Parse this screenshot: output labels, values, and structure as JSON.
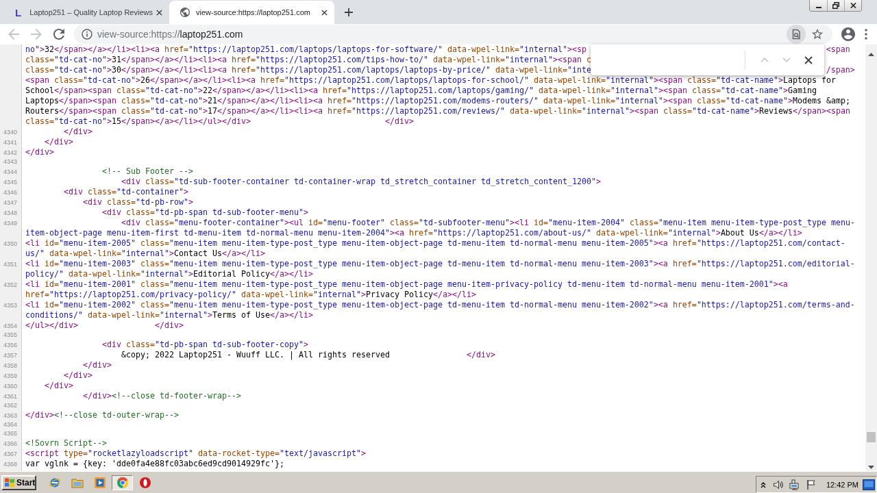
{
  "browser": {
    "tabs": [
      {
        "icon_letter": "L",
        "title": "Laptop251 – Quality Laptop Reviews",
        "selected": false
      },
      {
        "title": "view-source:https://laptop251.com",
        "selected": true
      }
    ],
    "toolbar": {
      "back": {
        "disabled": true
      },
      "forward": {
        "disabled": true
      },
      "address": {
        "scheme": "view-source:https://",
        "host": "laptop251.com"
      }
    },
    "find_bar": {
      "previous": {
        "disabled": true
      },
      "next": {
        "disabled": true
      }
    }
  },
  "source": {
    "lines": [
      {
        "rows": [
          {
            "segments": [
              {
                "kind": "value",
                "text": "no\""
              },
              {
                "kind": "tag",
                "text": ">"
              },
              {
                "kind": "text",
                "text": "32"
              },
              {
                "kind": "tag",
                "text": "</span></a></li><li><a "
              },
              {
                "kind": "attr",
                "text": "href="
              },
              {
                "kind": "value",
                "text": "\"https://laptop251.com/laptops/laptops-for-software/\""
              },
              {
                "kind": "attr",
                "text": " data-wpel-link="
              },
              {
                "kind": "value",
                "text": "\"internal\""
              },
              {
                "kind": "tag",
                "text": "><sp"
              }
            ],
            "right_of_find_bar": [
              {
                "kind": "tag",
                "text": "<span"
              }
            ]
          },
          {
            "segments": [
              {
                "kind": "attr",
                "text": "class="
              },
              {
                "kind": "value",
                "text": "\"td-cat-no\""
              },
              {
                "kind": "tag",
                "text": ">"
              },
              {
                "kind": "text",
                "text": "31"
              },
              {
                "kind": "tag",
                "text": "</span></a></li><li><a "
              },
              {
                "kind": "attr",
                "text": "href="
              },
              {
                "kind": "value",
                "text": "\"https://laptop251.com/tips-how-to/\""
              },
              {
                "kind": "attr",
                "text": " data-wpel-link="
              },
              {
                "kind": "value",
                "text": "\"internal\""
              },
              {
                "kind": "tag",
                "text": "><span "
              },
              {
                "kind": "attr",
                "text": "c"
              }
            ]
          },
          {
            "segments": [
              {
                "kind": "attr",
                "text": "class="
              },
              {
                "kind": "value",
                "text": "\"td-cat-no\""
              },
              {
                "kind": "tag",
                "text": ">"
              },
              {
                "kind": "text",
                "text": "30"
              },
              {
                "kind": "tag",
                "text": "</span></a></li><li><a "
              },
              {
                "kind": "attr",
                "text": "href="
              },
              {
                "kind": "value",
                "text": "\"https://laptop251.com/laptops/laptops-by-price/\""
              },
              {
                "kind": "attr",
                "text": " data-wpel-link="
              },
              {
                "kind": "value",
                "text": "\"inte"
              }
            ],
            "right_of_find_bar": [
              {
                "kind": "tag",
                "text": "/span>"
              }
            ]
          },
          {
            "segments": [
              {
                "kind": "tag",
                "text": "<span "
              },
              {
                "kind": "attr",
                "text": "class="
              },
              {
                "kind": "value",
                "text": "\"td-cat-no\""
              },
              {
                "kind": "tag",
                "text": ">"
              },
              {
                "kind": "text",
                "text": "26"
              },
              {
                "kind": "tag",
                "text": "</span></a></li><li><a "
              },
              {
                "kind": "attr",
                "text": "href="
              },
              {
                "kind": "value",
                "text": "\"https://laptop251.com/laptops/laptops-for-school/\""
              },
              {
                "kind": "attr",
                "text": " data-wpel-link="
              },
              {
                "kind": "value",
                "text": "\"internal\""
              },
              {
                "kind": "tag",
                "text": "><span "
              },
              {
                "kind": "attr",
                "text": "class="
              },
              {
                "kind": "value",
                "text": "\"td-cat-name\""
              },
              {
                "kind": "tag",
                "text": ">"
              },
              {
                "kind": "text",
                "text": "Laptops for"
              }
            ]
          },
          {
            "segments": [
              {
                "kind": "text",
                "text": "School"
              },
              {
                "kind": "tag",
                "text": "</span><span "
              },
              {
                "kind": "attr",
                "text": "class="
              },
              {
                "kind": "value",
                "text": "\"td-cat-no\""
              },
              {
                "kind": "tag",
                "text": ">"
              },
              {
                "kind": "text",
                "text": "22"
              },
              {
                "kind": "tag",
                "text": "</span></a></li><li><a "
              },
              {
                "kind": "attr",
                "text": "href="
              },
              {
                "kind": "value",
                "text": "\"https://laptop251.com/laptops/gaming/\""
              },
              {
                "kind": "attr",
                "text": " data-wpel-link="
              },
              {
                "kind": "value",
                "text": "\"internal\""
              },
              {
                "kind": "tag",
                "text": "><span "
              },
              {
                "kind": "attr",
                "text": "class="
              },
              {
                "kind": "value",
                "text": "\"td-cat-name\""
              },
              {
                "kind": "tag",
                "text": ">"
              },
              {
                "kind": "text",
                "text": "Gaming"
              }
            ]
          },
          {
            "segments": [
              {
                "kind": "text",
                "text": "Laptops"
              },
              {
                "kind": "tag",
                "text": "</span><span "
              },
              {
                "kind": "attr",
                "text": "class="
              },
              {
                "kind": "value",
                "text": "\"td-cat-no\""
              },
              {
                "kind": "tag",
                "text": ">"
              },
              {
                "kind": "text",
                "text": "21"
              },
              {
                "kind": "tag",
                "text": "</span></a></li><li><a "
              },
              {
                "kind": "attr",
                "text": "href="
              },
              {
                "kind": "value",
                "text": "\"https://laptop251.com/modems-routers/\""
              },
              {
                "kind": "attr",
                "text": " data-wpel-link="
              },
              {
                "kind": "value",
                "text": "\"internal\""
              },
              {
                "kind": "tag",
                "text": "><span "
              },
              {
                "kind": "attr",
                "text": "class="
              },
              {
                "kind": "value",
                "text": "\"td-cat-name\""
              },
              {
                "kind": "tag",
                "text": ">"
              },
              {
                "kind": "text",
                "text": "Modems &amp;"
              }
            ]
          },
          {
            "segments": [
              {
                "kind": "text",
                "text": "Routers"
              },
              {
                "kind": "tag",
                "text": "</span><span "
              },
              {
                "kind": "attr",
                "text": "class="
              },
              {
                "kind": "value",
                "text": "\"td-cat-no\""
              },
              {
                "kind": "tag",
                "text": ">"
              },
              {
                "kind": "text",
                "text": "17"
              },
              {
                "kind": "tag",
                "text": "</span></a></li><li><a "
              },
              {
                "kind": "attr",
                "text": "href="
              },
              {
                "kind": "value",
                "text": "\"https://laptop251.com/reviews/\""
              },
              {
                "kind": "attr",
                "text": " data-wpel-link="
              },
              {
                "kind": "value",
                "text": "\"internal\""
              },
              {
                "kind": "tag",
                "text": "><span "
              },
              {
                "kind": "attr",
                "text": "class="
              },
              {
                "kind": "value",
                "text": "\"td-cat-name\""
              },
              {
                "kind": "tag",
                "text": ">"
              },
              {
                "kind": "text",
                "text": "Reviews"
              },
              {
                "kind": "tag",
                "text": "</span><span"
              }
            ]
          },
          {
            "segments": [
              {
                "kind": "attr",
                "text": "class="
              },
              {
                "kind": "value",
                "text": "\"td-cat-no\""
              },
              {
                "kind": "tag",
                "text": ">"
              },
              {
                "kind": "text",
                "text": "15"
              },
              {
                "kind": "tag",
                "text": "</span></a></li></ul></div>                            </div>"
              }
            ]
          }
        ]
      },
      {
        "number": "4340",
        "rows": [
          {
            "segments": [
              {
                "kind": "tag",
                "text": "        </div>"
              }
            ]
          }
        ]
      },
      {
        "number": "4341",
        "rows": [
          {
            "segments": [
              {
                "kind": "tag",
                "text": "    </div>"
              }
            ]
          }
        ]
      },
      {
        "number": "4342",
        "rows": [
          {
            "segments": [
              {
                "kind": "tag",
                "text": "</div>"
              }
            ]
          }
        ]
      },
      {
        "number": "4343"
      },
      {
        "number": "4344",
        "rows": [
          {
            "segments": [
              {
                "kind": "comment",
                "text": "                <!-- Sub Footer -->"
              }
            ]
          }
        ]
      },
      {
        "number": "4345",
        "rows": [
          {
            "segments": [
              {
                "kind": "tag",
                "text": "                    <div "
              },
              {
                "kind": "attr",
                "text": "class="
              },
              {
                "kind": "value",
                "text": "\"td-sub-footer-container td-container-wrap td_stretch_container td_stretch_content_1200\""
              },
              {
                "kind": "tag",
                "text": ">"
              }
            ]
          }
        ]
      },
      {
        "number": "4346",
        "rows": [
          {
            "segments": [
              {
                "kind": "tag",
                "text": "        <div "
              },
              {
                "kind": "attr",
                "text": "class="
              },
              {
                "kind": "value",
                "text": "\"td-container\""
              },
              {
                "kind": "tag",
                "text": ">"
              }
            ]
          }
        ]
      },
      {
        "number": "4347",
        "rows": [
          {
            "segments": [
              {
                "kind": "tag",
                "text": "            <div "
              },
              {
                "kind": "attr",
                "text": "class="
              },
              {
                "kind": "value",
                "text": "\"td-pb-row\""
              },
              {
                "kind": "tag",
                "text": ">"
              }
            ]
          }
        ]
      },
      {
        "number": "4348",
        "rows": [
          {
            "segments": [
              {
                "kind": "tag",
                "text": "                <div "
              },
              {
                "kind": "attr",
                "text": "class="
              },
              {
                "kind": "value",
                "text": "\"td-pb-span td-sub-footer-menu\""
              },
              {
                "kind": "tag",
                "text": ">"
              }
            ]
          }
        ]
      },
      {
        "number": "4349",
        "rows": [
          {
            "segments": [
              {
                "kind": "tag",
                "text": "                    <div "
              },
              {
                "kind": "attr",
                "text": "class="
              },
              {
                "kind": "value",
                "text": "\"menu-footer-container\""
              },
              {
                "kind": "tag",
                "text": "><ul "
              },
              {
                "kind": "attr",
                "text": "id="
              },
              {
                "kind": "value",
                "text": "\"menu-footer\""
              },
              {
                "kind": "attr",
                "text": " class="
              },
              {
                "kind": "value",
                "text": "\"td-subfooter-menu\""
              },
              {
                "kind": "tag",
                "text": "><li "
              },
              {
                "kind": "attr",
                "text": "id="
              },
              {
                "kind": "value",
                "text": "\"menu-item-2004\""
              },
              {
                "kind": "attr",
                "text": " class="
              },
              {
                "kind": "value",
                "text": "\"menu-item menu-item-type-post_type menu-"
              }
            ]
          },
          {
            "segments": [
              {
                "kind": "value",
                "text": "item-object-page menu-item-first td-menu-item td-normal-menu menu-item-2004\""
              },
              {
                "kind": "tag",
                "text": "><a "
              },
              {
                "kind": "attr",
                "text": "href="
              },
              {
                "kind": "value",
                "text": "\"https://laptop251.com/about-us/\""
              },
              {
                "kind": "attr",
                "text": " data-wpel-link="
              },
              {
                "kind": "value",
                "text": "\"internal\""
              },
              {
                "kind": "tag",
                "text": ">"
              },
              {
                "kind": "text",
                "text": "About Us"
              },
              {
                "kind": "tag",
                "text": "</a></li>"
              }
            ]
          }
        ]
      },
      {
        "number": "4350",
        "rows": [
          {
            "segments": [
              {
                "kind": "tag",
                "text": "<li "
              },
              {
                "kind": "attr",
                "text": "id="
              },
              {
                "kind": "value",
                "text": "\"menu-item-2005\""
              },
              {
                "kind": "attr",
                "text": " class="
              },
              {
                "kind": "value",
                "text": "\"menu-item menu-item-type-post_type menu-item-object-page td-menu-item td-normal-menu menu-item-2005\""
              },
              {
                "kind": "tag",
                "text": "><a "
              },
              {
                "kind": "attr",
                "text": "href="
              },
              {
                "kind": "value",
                "text": "\"https://laptop251.com/contact-"
              }
            ]
          },
          {
            "segments": [
              {
                "kind": "value",
                "text": "us/\""
              },
              {
                "kind": "attr",
                "text": " data-wpel-link="
              },
              {
                "kind": "value",
                "text": "\"internal\""
              },
              {
                "kind": "tag",
                "text": ">"
              },
              {
                "kind": "text",
                "text": "Contact Us"
              },
              {
                "kind": "tag",
                "text": "</a></li>"
              }
            ]
          }
        ]
      },
      {
        "number": "4351",
        "rows": [
          {
            "segments": [
              {
                "kind": "tag",
                "text": "<li "
              },
              {
                "kind": "attr",
                "text": "id="
              },
              {
                "kind": "value",
                "text": "\"menu-item-2003\""
              },
              {
                "kind": "attr",
                "text": " class="
              },
              {
                "kind": "value",
                "text": "\"menu-item menu-item-type-post_type menu-item-object-page td-menu-item td-normal-menu menu-item-2003\""
              },
              {
                "kind": "tag",
                "text": "><a "
              },
              {
                "kind": "attr",
                "text": "href="
              },
              {
                "kind": "value",
                "text": "\"https://laptop251.com/editorial-"
              }
            ]
          },
          {
            "segments": [
              {
                "kind": "value",
                "text": "policy/\""
              },
              {
                "kind": "attr",
                "text": " data-wpel-link="
              },
              {
                "kind": "value",
                "text": "\"internal\""
              },
              {
                "kind": "tag",
                "text": ">"
              },
              {
                "kind": "text",
                "text": "Editorial Policy"
              },
              {
                "kind": "tag",
                "text": "</a></li>"
              }
            ]
          }
        ]
      },
      {
        "number": "4352",
        "rows": [
          {
            "segments": [
              {
                "kind": "tag",
                "text": "<li "
              },
              {
                "kind": "attr",
                "text": "id="
              },
              {
                "kind": "value",
                "text": "\"menu-item-2001\""
              },
              {
                "kind": "attr",
                "text": " class="
              },
              {
                "kind": "value",
                "text": "\"menu-item menu-item-type-post_type menu-item-object-page menu-item-privacy-policy td-menu-item td-normal-menu menu-item-2001\""
              },
              {
                "kind": "tag",
                "text": "><a"
              }
            ]
          },
          {
            "segments": [
              {
                "kind": "attr",
                "text": "href="
              },
              {
                "kind": "value",
                "text": "\"https://laptop251.com/privacy-policy/\""
              },
              {
                "kind": "attr",
                "text": " data-wpel-link="
              },
              {
                "kind": "value",
                "text": "\"internal\""
              },
              {
                "kind": "tag",
                "text": ">"
              },
              {
                "kind": "text",
                "text": "Privacy Policy"
              },
              {
                "kind": "tag",
                "text": "</a></li>"
              }
            ]
          }
        ]
      },
      {
        "number": "4353",
        "rows": [
          {
            "segments": [
              {
                "kind": "tag",
                "text": "<li "
              },
              {
                "kind": "attr",
                "text": "id="
              },
              {
                "kind": "value",
                "text": "\"menu-item-2002\""
              },
              {
                "kind": "attr",
                "text": " class="
              },
              {
                "kind": "value",
                "text": "\"menu-item menu-item-type-post_type menu-item-object-page td-menu-item td-normal-menu menu-item-2002\""
              },
              {
                "kind": "tag",
                "text": "><a "
              },
              {
                "kind": "attr",
                "text": "href="
              },
              {
                "kind": "value",
                "text": "\"https://laptop251.com/terms-and-"
              }
            ]
          },
          {
            "segments": [
              {
                "kind": "value",
                "text": "conditions/\""
              },
              {
                "kind": "attr",
                "text": " data-wpel-link="
              },
              {
                "kind": "value",
                "text": "\"internal\""
              },
              {
                "kind": "tag",
                "text": ">"
              },
              {
                "kind": "text",
                "text": "Terms of Use"
              },
              {
                "kind": "tag",
                "text": "</a></li>"
              }
            ]
          }
        ]
      },
      {
        "number": "4354",
        "rows": [
          {
            "segments": [
              {
                "kind": "tag",
                "text": "</ul></div>                </div>"
              }
            ]
          }
        ]
      },
      {
        "number": "4355"
      },
      {
        "number": "4356",
        "rows": [
          {
            "segments": [
              {
                "kind": "tag",
                "text": "                <div "
              },
              {
                "kind": "attr",
                "text": "class="
              },
              {
                "kind": "value",
                "text": "\"td-pb-span td-sub-footer-copy\""
              },
              {
                "kind": "tag",
                "text": ">"
              }
            ]
          }
        ]
      },
      {
        "number": "4357",
        "rows": [
          {
            "segments": [
              {
                "kind": "text",
                "text": "                    &copy; 2022 Laptop251 - Wuuff LLC. | All rights reserved                "
              },
              {
                "kind": "tag",
                "text": "</div>"
              }
            ]
          }
        ]
      },
      {
        "number": "4358",
        "rows": [
          {
            "segments": [
              {
                "kind": "tag",
                "text": "            </div>"
              }
            ]
          }
        ]
      },
      {
        "number": "4359",
        "rows": [
          {
            "segments": [
              {
                "kind": "tag",
                "text": "        </div>"
              }
            ]
          }
        ]
      },
      {
        "number": "4360",
        "rows": [
          {
            "segments": [
              {
                "kind": "tag",
                "text": "    </div>"
              }
            ]
          }
        ]
      },
      {
        "number": "4361",
        "rows": [
          {
            "segments": [
              {
                "kind": "tag",
                "text": "            </div>"
              },
              {
                "kind": "comment",
                "text": "<!--close td-footer-wrap-->"
              }
            ]
          }
        ]
      },
      {
        "number": "4362"
      },
      {
        "number": "4363",
        "rows": [
          {
            "segments": [
              {
                "kind": "tag",
                "text": "</div>"
              },
              {
                "kind": "comment",
                "text": "<!--close td-outer-wrap-->"
              }
            ]
          }
        ]
      },
      {
        "number": "4364"
      },
      {
        "number": "4365"
      },
      {
        "number": "4366",
        "rows": [
          {
            "segments": [
              {
                "kind": "comment",
                "text": "<!Sovrn Script-->"
              }
            ]
          }
        ]
      },
      {
        "number": "4367",
        "rows": [
          {
            "segments": [
              {
                "kind": "tag",
                "text": "<script "
              },
              {
                "kind": "attr",
                "text": "type="
              },
              {
                "kind": "value",
                "text": "\"rocketlazyloadscript\""
              },
              {
                "kind": "attr",
                "text": " data-rocket-type="
              },
              {
                "kind": "value",
                "text": "\"text/javascript\""
              },
              {
                "kind": "tag",
                "text": ">"
              }
            ]
          }
        ]
      },
      {
        "number": "4368",
        "rows": [
          {
            "segments": [
              {
                "kind": "text",
                "text": "var vglnk = {key: 'dde0fa4e88fc03abc6ed9cd9014929fc'};"
              }
            ]
          }
        ]
      }
    ]
  },
  "taskbar": {
    "start": "Start",
    "apps": [
      {
        "selected": false
      },
      {
        "selected": false
      },
      {
        "selected": false
      },
      {
        "selected": true
      },
      {
        "selected": false
      }
    ],
    "clock": "12:42 PM"
  }
}
